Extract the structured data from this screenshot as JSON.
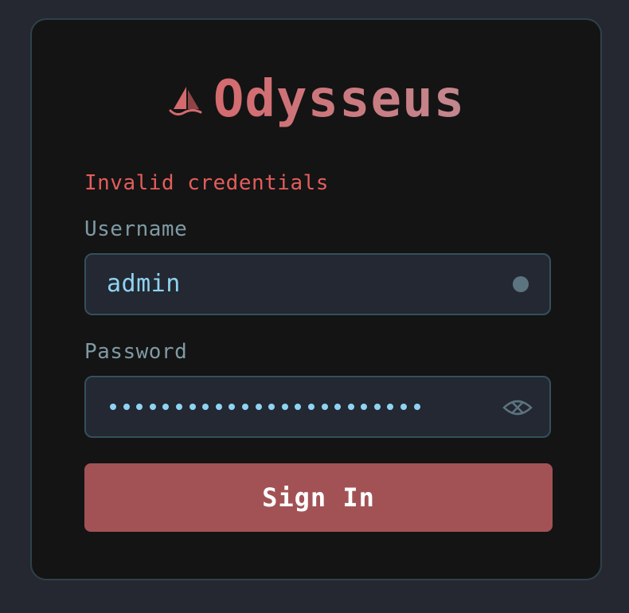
{
  "brand": {
    "name": "Odysseus",
    "icon": "sail-boat-icon"
  },
  "form": {
    "error_message": "Invalid credentials",
    "username": {
      "label": "Username",
      "value": "admin",
      "indicator": "status-dot-icon"
    },
    "password": {
      "label": "Password",
      "masked_length": 24,
      "toggle_icon": "eye-slash-icon"
    },
    "submit_label": "Sign In"
  },
  "colors": {
    "background": "#252831",
    "card": "#141414",
    "card_border": "#2e4149",
    "error": "#e35d5b",
    "label": "#7f9aa4",
    "input_text": "#8fd3f2",
    "input_bg": "#232833",
    "button": "#a25255",
    "brand_gradient_start": "#d46a6e",
    "brand_gradient_end": "#c2878e"
  }
}
